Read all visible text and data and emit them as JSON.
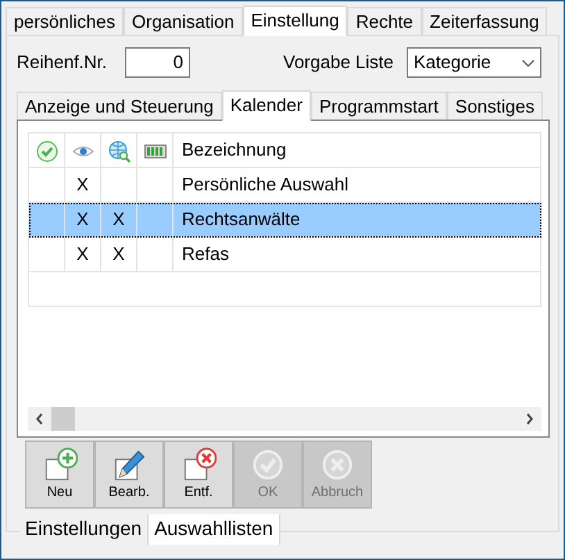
{
  "top_tabs": [
    {
      "label": "persönliches",
      "selected": false
    },
    {
      "label": "Organisation",
      "selected": false
    },
    {
      "label": "Einstellung",
      "selected": true
    },
    {
      "label": "Rechte",
      "selected": false
    },
    {
      "label": "Zeiterfassung",
      "selected": false
    }
  ],
  "order_field": {
    "label": "Reihenf.Nr.",
    "value": "0"
  },
  "default_list": {
    "label": "Vorgabe Liste",
    "value": "Kategorie"
  },
  "sub_tabs": [
    {
      "label": "Anzeige und Steuerung",
      "selected": false
    },
    {
      "label": "Kalender",
      "selected": true
    },
    {
      "label": "Programmstart",
      "selected": false
    },
    {
      "label": "Sonstiges",
      "selected": false
    }
  ],
  "table": {
    "header": "Bezeichnung",
    "rows": [
      {
        "column_2": "X",
        "name": "Persönliche Auswahl",
        "selected": false
      },
      {
        "column_2": "X",
        "column_3": "X",
        "name": "Rechtsanwälte",
        "selected": true
      },
      {
        "column_2": "X",
        "column_3": "X",
        "name": "Refas",
        "selected": false
      }
    ]
  },
  "buttons": [
    {
      "kind": "new",
      "label": "Neu",
      "disabled": false
    },
    {
      "kind": "edit",
      "label": "Bearb.",
      "disabled": false
    },
    {
      "kind": "delete",
      "label": "Entf.",
      "disabled": false
    },
    {
      "kind": "ok",
      "label": "OK",
      "disabled": true
    },
    {
      "kind": "cancel",
      "label": "Abbruch",
      "disabled": true
    }
  ],
  "bottom_tabs": [
    {
      "label": "Einstellungen",
      "selected": false
    },
    {
      "label": "Auswahllisten",
      "selected": true
    }
  ]
}
